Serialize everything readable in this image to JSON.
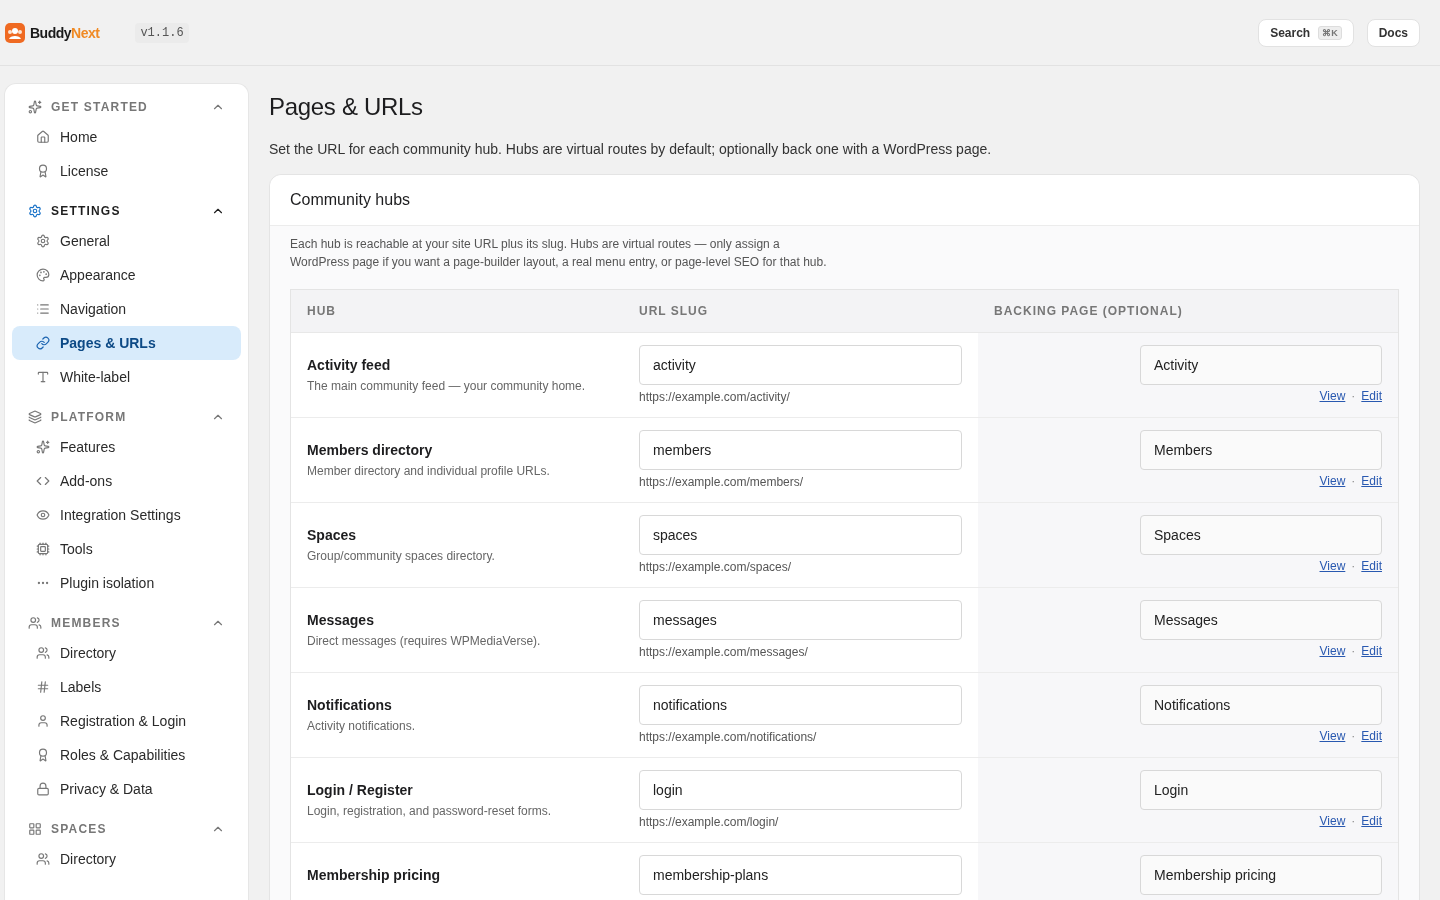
{
  "header": {
    "logo": {
      "first": "Buddy",
      "second": "Next"
    },
    "version": "v1.1.6",
    "search": {
      "label": "Search",
      "shortcut": "⌘K"
    },
    "docs": "Docs"
  },
  "sidebar": {
    "sections": [
      {
        "title": "GET STARTED",
        "active": false,
        "expanded": true,
        "items": [
          {
            "label": "Home",
            "selected": false
          },
          {
            "label": "License",
            "selected": false
          }
        ]
      },
      {
        "title": "SETTINGS",
        "active": true,
        "expanded": true,
        "items": [
          {
            "label": "General",
            "selected": false
          },
          {
            "label": "Appearance",
            "selected": false
          },
          {
            "label": "Navigation",
            "selected": false
          },
          {
            "label": "Pages & URLs",
            "selected": true
          },
          {
            "label": "White-label",
            "selected": false
          }
        ]
      },
      {
        "title": "PLATFORM",
        "active": false,
        "expanded": true,
        "items": [
          {
            "label": "Features",
            "selected": false
          },
          {
            "label": "Add-ons",
            "selected": false
          },
          {
            "label": "Integration Settings",
            "selected": false
          },
          {
            "label": "Tools",
            "selected": false
          },
          {
            "label": "Plugin isolation",
            "selected": false
          }
        ]
      },
      {
        "title": "MEMBERS",
        "active": false,
        "expanded": true,
        "items": [
          {
            "label": "Directory",
            "selected": false
          },
          {
            "label": "Labels",
            "selected": false
          },
          {
            "label": "Registration & Login",
            "selected": false
          },
          {
            "label": "Roles & Capabilities",
            "selected": false
          },
          {
            "label": "Privacy & Data",
            "selected": false
          }
        ]
      },
      {
        "title": "SPACES",
        "active": false,
        "expanded": true,
        "items": [
          {
            "label": "Directory",
            "selected": false
          }
        ]
      }
    ]
  },
  "page": {
    "title": "Pages & URLs",
    "description": "Set the URL for each community hub. Hubs are virtual routes by default; optionally back one with a WordPress page.",
    "card": {
      "title": "Community hubs",
      "intro": "Each hub is reachable at your site URL plus its slug. Hubs are virtual routes — only assign a WordPress page if you want a page-builder layout, a real menu entry, or page-level SEO for that hub.",
      "table": {
        "columns": [
          "HUB",
          "URL SLUG",
          "BACKING PAGE (OPTIONAL)"
        ],
        "rows": [
          {
            "name": "Activity feed",
            "description": "The main community feed — your community home.",
            "slug": "activity",
            "url": "https://example.com/activity/",
            "page": "Activity",
            "view": "View",
            "separator": "·",
            "edit": "Edit"
          },
          {
            "name": "Members directory",
            "description": "Member directory and individual profile URLs.",
            "slug": "members",
            "url": "https://example.com/members/",
            "page": "Members",
            "view": "View",
            "separator": "·",
            "edit": "Edit"
          },
          {
            "name": "Spaces",
            "description": "Group/community spaces directory.",
            "slug": "spaces",
            "url": "https://example.com/spaces/",
            "page": "Spaces",
            "view": "View",
            "separator": "·",
            "edit": "Edit"
          },
          {
            "name": "Messages",
            "description": "Direct messages (requires WPMediaVerse).",
            "slug": "messages",
            "url": "https://example.com/messages/",
            "page": "Messages",
            "view": "View",
            "separator": "·",
            "edit": "Edit"
          },
          {
            "name": "Notifications",
            "description": "Activity notifications.",
            "slug": "notifications",
            "url": "https://example.com/notifications/",
            "page": "Notifications",
            "view": "View",
            "separator": "·",
            "edit": "Edit"
          },
          {
            "name": "Login / Register",
            "description": "Login, registration, and password-reset forms.",
            "slug": "login",
            "url": "https://example.com/login/",
            "page": "Login",
            "view": "View",
            "separator": "·",
            "edit": "Edit"
          },
          {
            "name": "Membership pricing",
            "slug": "membership-plans",
            "page": "Membership pricing"
          }
        ]
      }
    }
  }
}
